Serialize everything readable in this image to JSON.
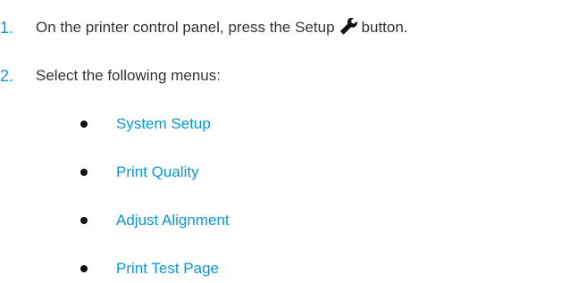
{
  "steps": [
    {
      "number": "1.",
      "text_before": "On the printer control panel, press the Setup",
      "icon": "wrench-icon",
      "text_after": "button."
    },
    {
      "number": "2.",
      "text": "Select the following menus:"
    }
  ],
  "menus": [
    {
      "label": "System Setup"
    },
    {
      "label": "Print Quality"
    },
    {
      "label": "Adjust Alignment"
    },
    {
      "label": "Print Test Page"
    }
  ],
  "colors": {
    "accent": "#0a96d6",
    "text": "#333333",
    "bullet": "#111111"
  }
}
